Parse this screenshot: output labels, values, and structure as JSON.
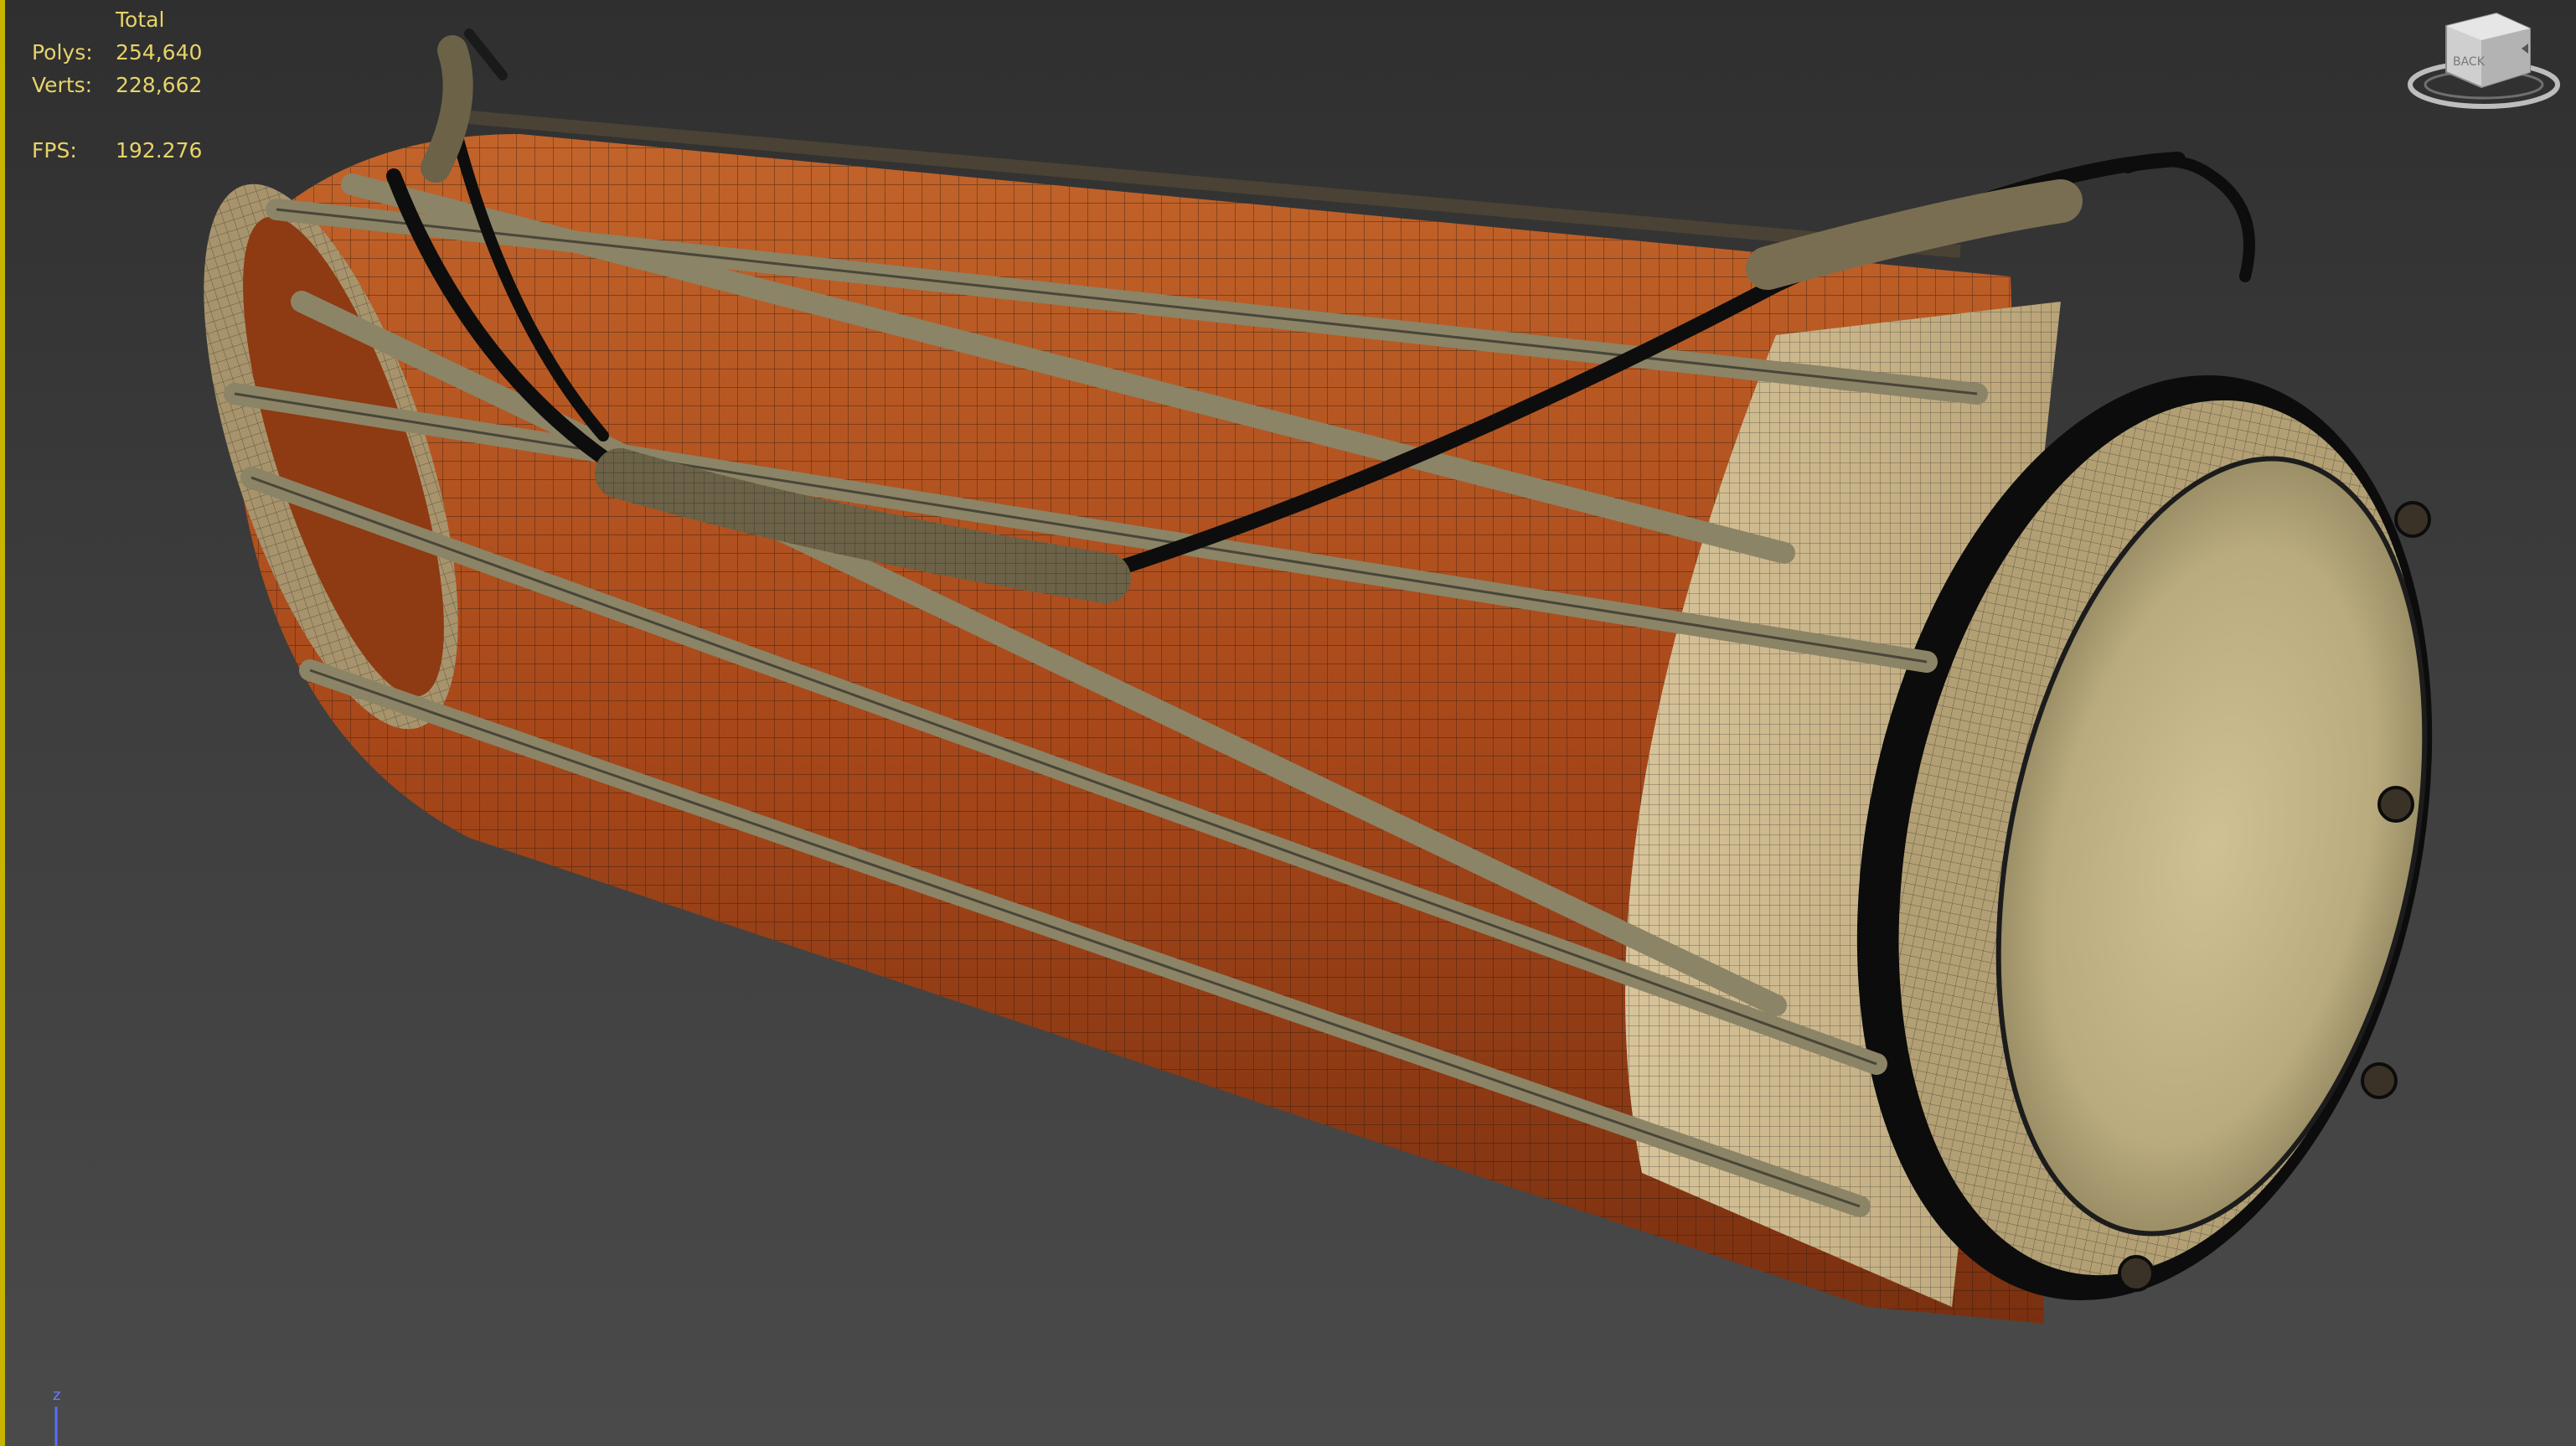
{
  "viewport": {
    "background_color": "#3a3a3a",
    "active_border_color": "#c8b400"
  },
  "stats": {
    "header": "Total",
    "polys_label": "Polys:",
    "polys_value": "254,640",
    "verts_label": "Verts:",
    "verts_value": "228,662",
    "fps_label": "FPS:",
    "fps_value": "192.276",
    "text_color": "#e6d36a"
  },
  "viewcube": {
    "face_label": "BACK",
    "icon": "viewcube-icon"
  },
  "axis_gizmo": {
    "z_label": "z",
    "icon": "axis-tripod-icon"
  },
  "model": {
    "wood_color": "#b4541e",
    "rope_color": "#8c8466",
    "skin_color": "#d6c79a",
    "wire_color": "#1a1a1a"
  }
}
